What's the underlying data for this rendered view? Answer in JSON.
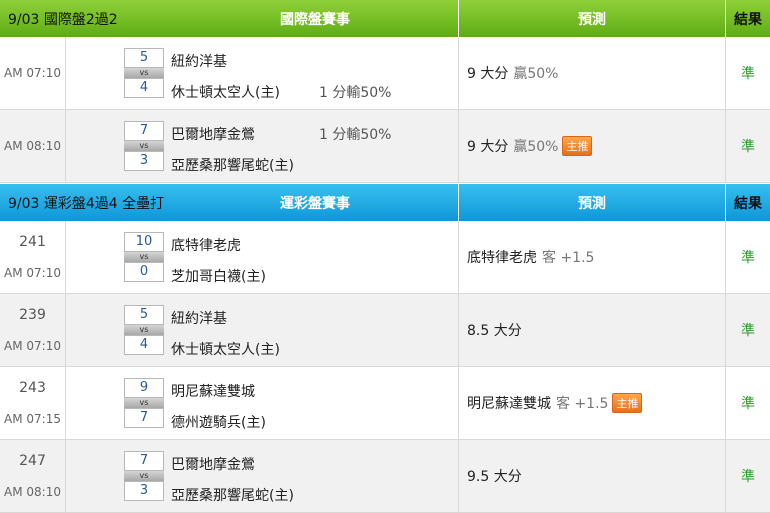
{
  "intl": {
    "date": "9/03 國際盤2過2",
    "event_label": "國際盤賽事",
    "predict_label": "預測",
    "result_label": "結果",
    "rows": [
      {
        "num": "",
        "time": "AM 07:10",
        "home_score": "5",
        "vs": "vs",
        "away_score": "4",
        "team_home": "紐約洋基",
        "team_away": "休士頓太空人(主)",
        "hcp_home": "",
        "hcp_away": "1 分輸50%",
        "pred": "9 大分",
        "pred_sub": "贏50%",
        "badge": "",
        "result": "準"
      },
      {
        "num": "",
        "time": "AM 08:10",
        "home_score": "7",
        "vs": "vs",
        "away_score": "3",
        "team_home": "巴爾地摩金鶯",
        "team_away": "亞歷桑那響尾蛇(主)",
        "hcp_home": "1 分輸50%",
        "hcp_away": "",
        "pred": "9 大分",
        "pred_sub": "贏50%",
        "badge": "主推",
        "result": "準"
      }
    ]
  },
  "lottery": {
    "date": "9/03 運彩盤4過4 全壘打",
    "event_label": "運彩盤賽事",
    "predict_label": "預測",
    "result_label": "結果",
    "rows": [
      {
        "num": "241",
        "time": "AM 07:10",
        "home_score": "10",
        "vs": "vs",
        "away_score": "0",
        "team_home": "底特律老虎",
        "team_away": "芝加哥白襪(主)",
        "hcp_home": "",
        "hcp_away": "",
        "pred": "底特律老虎",
        "pred_sub": "客 +1.5",
        "badge": "",
        "result": "準"
      },
      {
        "num": "239",
        "time": "AM 07:10",
        "home_score": "5",
        "vs": "vs",
        "away_score": "4",
        "team_home": "紐約洋基",
        "team_away": "休士頓太空人(主)",
        "hcp_home": "",
        "hcp_away": "",
        "pred": "8.5 大分",
        "pred_sub": "",
        "badge": "",
        "result": "準"
      },
      {
        "num": "243",
        "time": "AM 07:15",
        "home_score": "9",
        "vs": "vs",
        "away_score": "7",
        "team_home": "明尼蘇達雙城",
        "team_away": "德州遊騎兵(主)",
        "hcp_home": "",
        "hcp_away": "",
        "pred": "明尼蘇達雙城",
        "pred_sub": "客 +1.5",
        "badge": "主推",
        "result": "準"
      },
      {
        "num": "247",
        "time": "AM 08:10",
        "home_score": "7",
        "vs": "vs",
        "away_score": "3",
        "team_home": "巴爾地摩金鶯",
        "team_away": "亞歷桑那響尾蛇(主)",
        "hcp_home": "",
        "hcp_away": "",
        "pred": "9.5 大分",
        "pred_sub": "",
        "badge": "",
        "result": "準"
      }
    ]
  },
  "colors": {
    "green_header": "#6bb81e",
    "blue_header": "#1aa6e2",
    "result_green": "#2aa02a",
    "badge_orange": "#f08a2a"
  }
}
